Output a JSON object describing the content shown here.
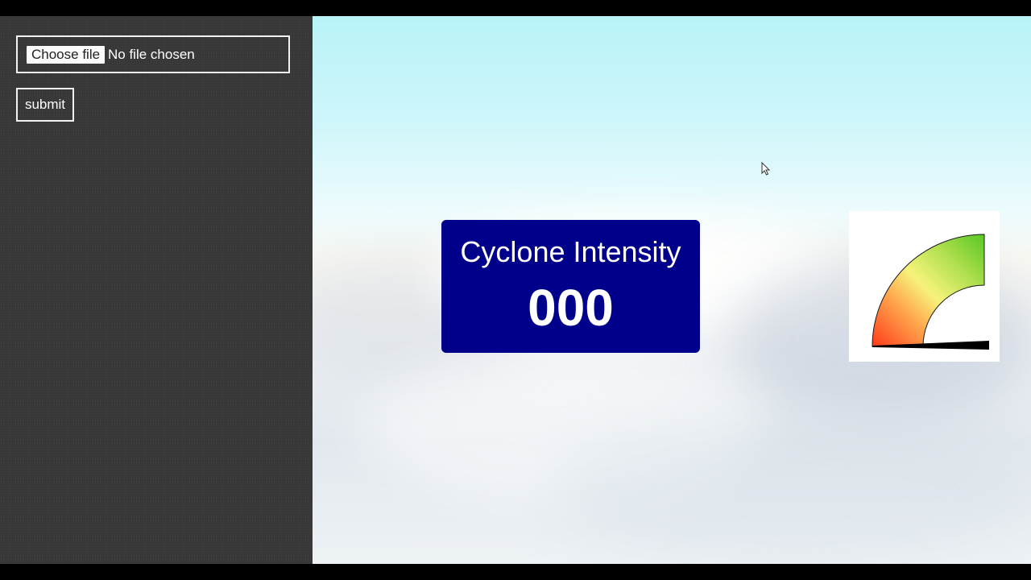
{
  "upload": {
    "choose_label": "Choose file",
    "status": "No file chosen"
  },
  "submit_label": "submit",
  "intensity": {
    "title": "Cyclone Intensity",
    "value": "000"
  },
  "gauge": {
    "colors": [
      "#ff3b1a",
      "#ffa64d",
      "#f6f37a",
      "#aede4e",
      "#58c823"
    ],
    "needle_color": "#000000"
  }
}
